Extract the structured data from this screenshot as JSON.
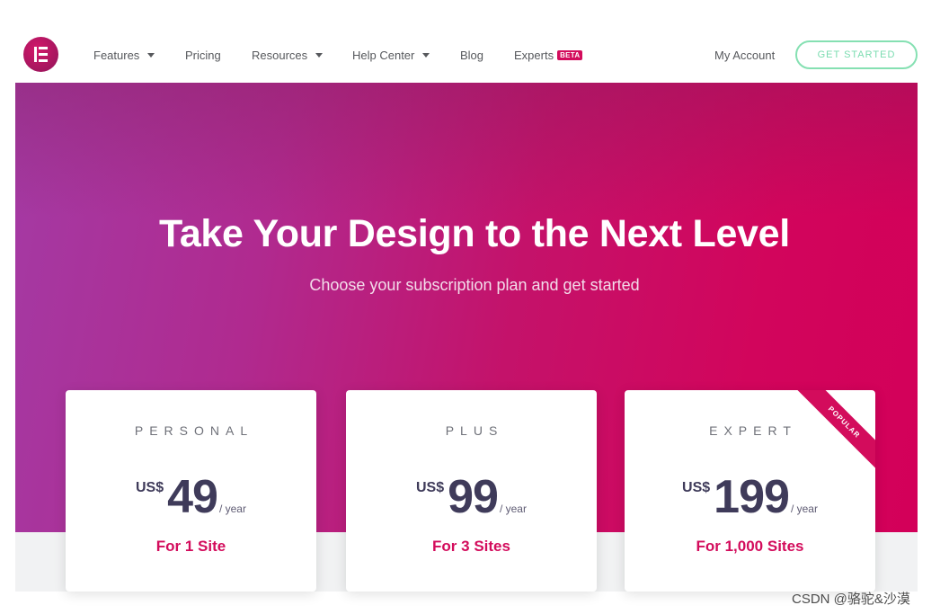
{
  "nav": {
    "items": [
      {
        "label": "Features",
        "dropdown": true
      },
      {
        "label": "Pricing",
        "dropdown": false
      },
      {
        "label": "Resources",
        "dropdown": true
      },
      {
        "label": "Help Center",
        "dropdown": true
      },
      {
        "label": "Blog",
        "dropdown": false
      },
      {
        "label": "Experts",
        "dropdown": false,
        "badge": "BETA"
      }
    ],
    "account": "My Account",
    "cta": "GET STARTED"
  },
  "hero": {
    "title": "Take Your Design to the Next Level",
    "subtitle": "Choose your subscription plan and get started"
  },
  "plans": [
    {
      "name": "PERSONAL",
      "currency": "US$",
      "price": "49",
      "period": "/ year",
      "sites": "For 1 Site"
    },
    {
      "name": "PLUS",
      "currency": "US$",
      "price": "99",
      "period": "/ year",
      "sites": "For 3 Sites"
    },
    {
      "name": "EXPERT",
      "currency": "US$",
      "price": "199",
      "period": "/ year",
      "sites": "For 1,000 Sites",
      "ribbon": "POPULAR"
    }
  ],
  "watermark": "CSDN @骆驼&沙漠",
  "colors": {
    "accent": "#d30c5c",
    "cta_border": "#85e0b2",
    "price_text": "#3f3b5a",
    "hero_start": "#a43aa4",
    "hero_end": "#d30059"
  },
  "icons": {
    "logo": "elementor-logo-icon",
    "dropdown": "caret-down-icon"
  }
}
